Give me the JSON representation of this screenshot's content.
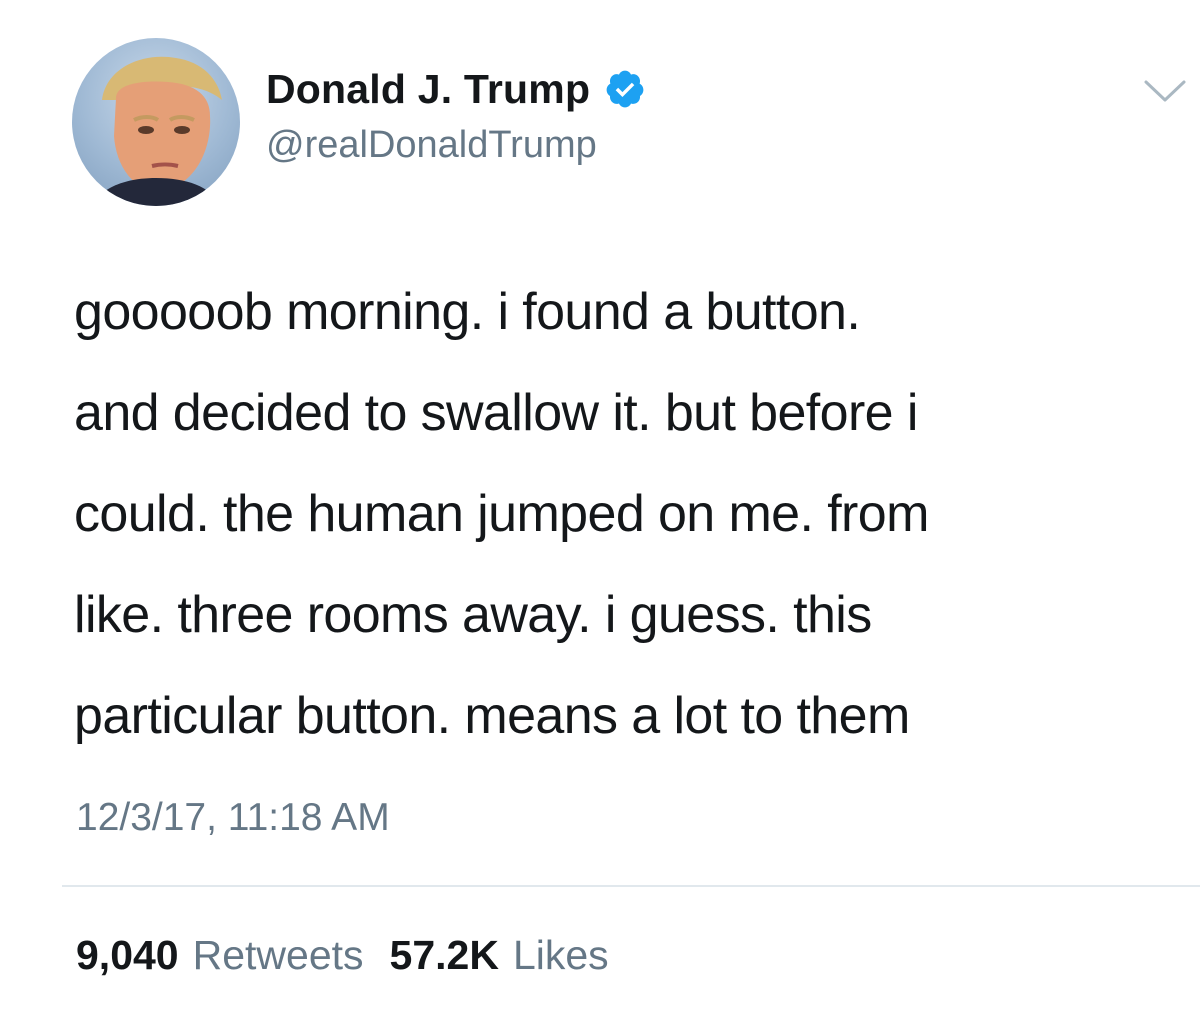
{
  "author": {
    "display_name": "Donald J. Trump",
    "handle": "@realDonaldTrump",
    "verified": true,
    "verified_color": "#1da1f2"
  },
  "icons": {
    "verified": "verified-badge-icon",
    "menu": "chevron-down-icon",
    "avatar": "profile-photo"
  },
  "tweet": {
    "lines": [
      "gooooob morning. i found a button.",
      "and decided to swallow it. but before i",
      "could. the human jumped on me. from",
      "like. three rooms away. i guess. this",
      "particular button. means a lot to them"
    ],
    "timestamp": "12/3/17, 11:18 AM"
  },
  "stats": {
    "retweets_count": "9,040",
    "retweets_label": "Retweets",
    "likes_count": "57.2K",
    "likes_label": "Likes"
  },
  "colors": {
    "text_primary": "#14171a",
    "text_secondary": "#657786",
    "divider": "#e1e8ed"
  }
}
